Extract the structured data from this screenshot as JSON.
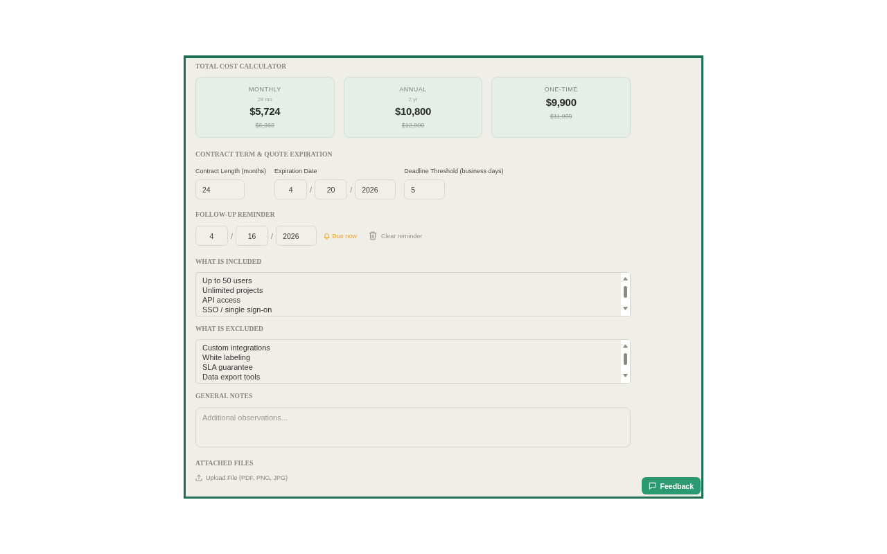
{
  "cost_calculator": {
    "heading": "TOTAL COST CALCULATOR",
    "cards": [
      {
        "label": "MONTHLY",
        "period": "24 mo",
        "price": "$5,724",
        "original_price": "$6,360"
      },
      {
        "label": "ANNUAL",
        "period": "2 yr",
        "price": "$10,800",
        "original_price": "$12,000"
      },
      {
        "label": "ONE-TIME",
        "price": "$9,900",
        "original_price": "$11,000"
      }
    ]
  },
  "contract_term": {
    "heading": "CONTRACT TERM & QUOTE EXPIRATION",
    "contract_length": {
      "label": "Contract Length (months)",
      "value": "24"
    },
    "expiration_date": {
      "label": "Expiration Date",
      "parts": [
        "4",
        "20",
        "2026"
      ],
      "separators": [
        "/",
        "/"
      ]
    },
    "deadline_threshold": {
      "label": "Deadline Threshold (business days)",
      "value": "5"
    }
  },
  "follow_up_reminder": {
    "heading": "FOLLOW-UP REMINDER",
    "date": {
      "parts": [
        "4",
        "16",
        "2026"
      ],
      "separators": [
        "/",
        "/"
      ]
    },
    "status": "Due now",
    "clear_button": "Clear reminder"
  },
  "included": {
    "heading": "WHAT IS INCLUDED",
    "items": [
      "Up to 50 users",
      "Unlimited projects",
      "API access",
      "SSO / single sign-on"
    ]
  },
  "excluded": {
    "heading": "WHAT IS EXCLUDED",
    "items": [
      "Custom integrations",
      "White labeling",
      "SLA guarantee",
      "Data export tools"
    ]
  },
  "general_notes": {
    "heading": "GENERAL NOTES",
    "placeholder": "Additional observations..."
  },
  "attached_files": {
    "heading": "ATTACHED FILES",
    "upload_button": "Upload File (PDF, PNG, JPG)"
  },
  "feedback_button": "Feedback"
}
